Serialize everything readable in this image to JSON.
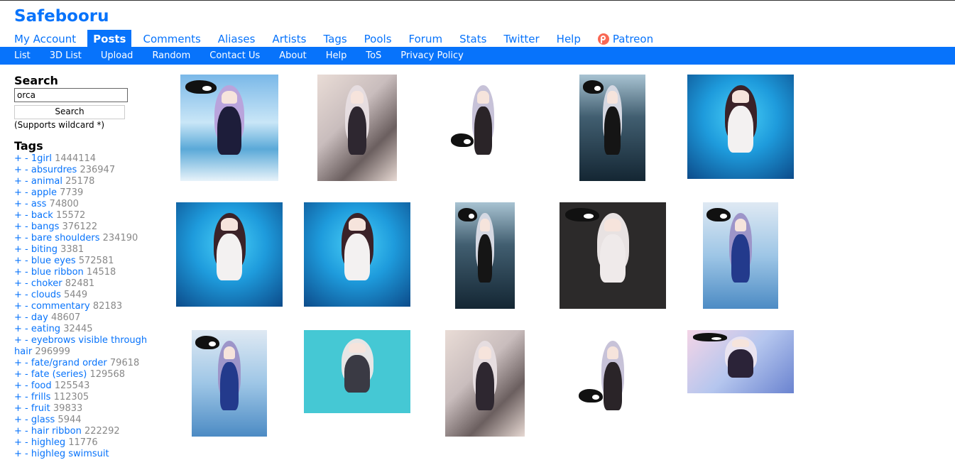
{
  "site": {
    "title": "Safebooru"
  },
  "nav": {
    "items": [
      {
        "label": "My Account",
        "name": "nav-my-account"
      },
      {
        "label": "Posts",
        "name": "nav-posts",
        "active": true
      },
      {
        "label": "Comments",
        "name": "nav-comments"
      },
      {
        "label": "Aliases",
        "name": "nav-aliases"
      },
      {
        "label": "Artists",
        "name": "nav-artists"
      },
      {
        "label": "Tags",
        "name": "nav-tags"
      },
      {
        "label": "Pools",
        "name": "nav-pools"
      },
      {
        "label": "Forum",
        "name": "nav-forum"
      },
      {
        "label": "Stats",
        "name": "nav-stats"
      },
      {
        "label": "Twitter",
        "name": "nav-twitter"
      },
      {
        "label": "Help",
        "name": "nav-help"
      },
      {
        "label": "Patreon",
        "name": "nav-patreon",
        "icon": "patreon-icon"
      }
    ]
  },
  "subnav": {
    "items": [
      "List",
      "3D List",
      "Upload",
      "Random",
      "Contact Us",
      "About",
      "Help",
      "ToS",
      "Privacy Policy"
    ]
  },
  "search": {
    "heading": "Search",
    "value": "orca",
    "button": "Search",
    "note": "(Supports wildcard *)"
  },
  "tags": {
    "heading": "Tags",
    "plus": "+",
    "minus": "-",
    "items": [
      {
        "name": "1girl",
        "count": "1444114"
      },
      {
        "name": "absurdres",
        "count": "236947"
      },
      {
        "name": "animal",
        "count": "25178"
      },
      {
        "name": "apple",
        "count": "7739"
      },
      {
        "name": "ass",
        "count": "74800"
      },
      {
        "name": "back",
        "count": "15572"
      },
      {
        "name": "bangs",
        "count": "376122"
      },
      {
        "name": "bare shoulders",
        "count": "234190"
      },
      {
        "name": "biting",
        "count": "3381"
      },
      {
        "name": "blue eyes",
        "count": "572581"
      },
      {
        "name": "blue ribbon",
        "count": "14518"
      },
      {
        "name": "choker",
        "count": "82481"
      },
      {
        "name": "clouds",
        "count": "5449"
      },
      {
        "name": "commentary",
        "count": "82183"
      },
      {
        "name": "day",
        "count": "48607"
      },
      {
        "name": "eating",
        "count": "32445"
      },
      {
        "name": "eyebrows visible through hair",
        "count": "296999"
      },
      {
        "name": "fate/grand order",
        "count": "79618"
      },
      {
        "name": "fate (series)",
        "count": "129568"
      },
      {
        "name": "food",
        "count": "125543"
      },
      {
        "name": "frills",
        "count": "112305"
      },
      {
        "name": "fruit",
        "count": "39833"
      },
      {
        "name": "glass",
        "count": "5944"
      },
      {
        "name": "hair ribbon",
        "count": "222292"
      },
      {
        "name": "highleg",
        "count": "11776"
      },
      {
        "name": "highleg swimsuit",
        "count": ""
      }
    ]
  },
  "colors": {
    "accent": "#0773fb",
    "count_text": "#888888"
  },
  "thumbnails": [
    {
      "name": "thumb-orca-apple-swimsuit",
      "scene": "sky"
    },
    {
      "name": "thumb-dark-dress-flowers",
      "scene": "collage"
    },
    {
      "name": "thumb-girl-holding-orca-plush",
      "scene": "white"
    },
    {
      "name": "thumb-dark-water-orca",
      "scene": "deep"
    },
    {
      "name": "thumb-aquarium-catgirl",
      "scene": "aquarium"
    },
    {
      "name": "thumb-aquarium-catgirl-2",
      "scene": "aquarium"
    },
    {
      "name": "thumb-aquarium-catgirl-3",
      "scene": "aquarium"
    },
    {
      "name": "thumb-deep-blue-poster",
      "scene": "deep"
    },
    {
      "name": "thumb-orca-circle-art",
      "scene": "dark"
    },
    {
      "name": "thumb-blue-swimsuit-back",
      "scene": "sea"
    },
    {
      "name": "thumb-blue-swimsuit-back-2",
      "scene": "sea"
    },
    {
      "name": "thumb-chibi-wolf-group",
      "scene": "teal"
    },
    {
      "name": "thumb-dark-dress-flowers-2",
      "scene": "collage"
    },
    {
      "name": "thumb-silver-hair-orca",
      "scene": "white"
    },
    {
      "name": "thumb-orca-rider-spear",
      "scene": "pastel"
    }
  ]
}
